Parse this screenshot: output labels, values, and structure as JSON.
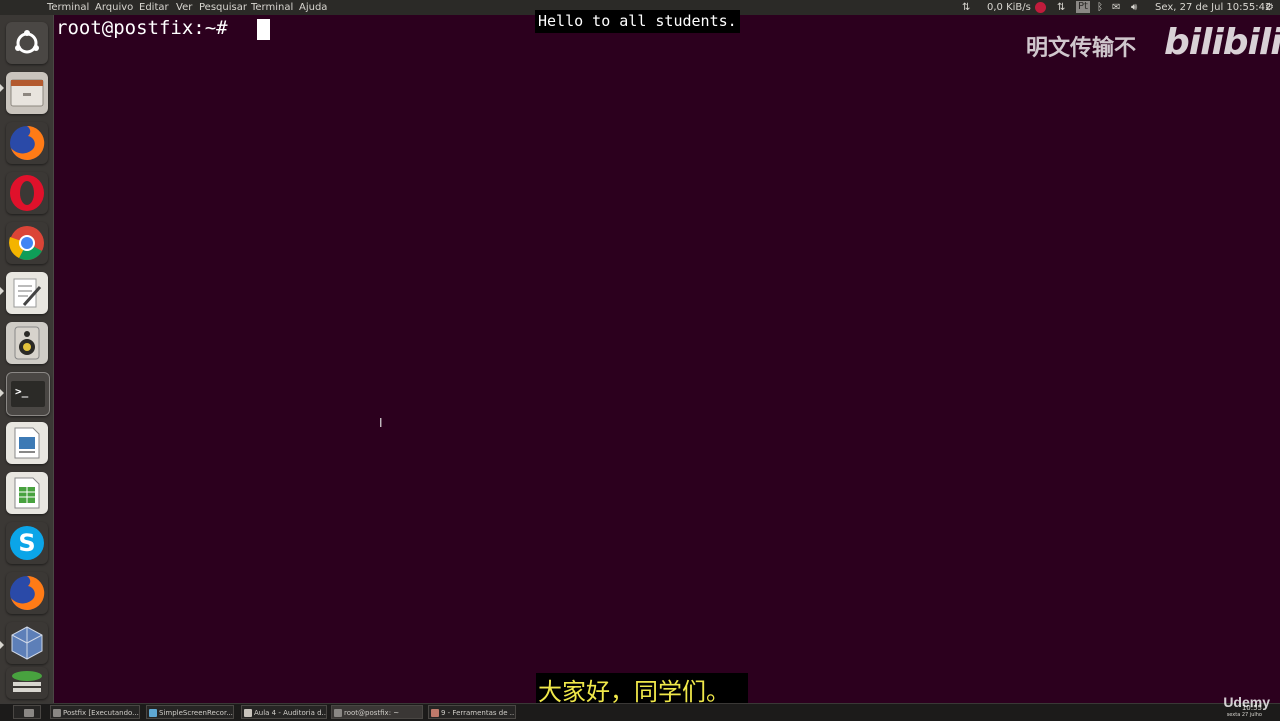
{
  "topbar": {
    "menu": [
      "Terminal",
      "Arquivo",
      "Editar",
      "Ver",
      "Pesquisar",
      "Terminal",
      "Ajuda"
    ],
    "network_speed": "0,0 KiB/s",
    "datetime": "Sex, 27 de Jul 10:55:42",
    "keyboard_layout": "Pt"
  },
  "terminal": {
    "prompt": "root@postfix:~# "
  },
  "subtitles": {
    "english": "Hello to all students.",
    "chinese": "大家好，同学们。"
  },
  "watermark": {
    "text": "明文传输不",
    "logo": "bilibili"
  },
  "launcher": {
    "icons": [
      "ubuntu-dash-icon",
      "files-icon",
      "firefox-icon",
      "opera-icon",
      "chrome-icon",
      "text-editor-icon",
      "speaker-icon",
      "terminal-icon",
      "libreoffice-writer-icon",
      "libreoffice-calc-icon",
      "skype-icon",
      "firefox-icon",
      "virtualbox-icon",
      "layers-icon"
    ]
  },
  "taskbar": {
    "tasks": [
      "Postfix [Executando...",
      "SimpleScreenRecor...",
      "Aula 4 - Auditoria d...",
      "root@postfix: ~",
      "9 - Ferramentas de ..."
    ],
    "clock_time": "10:55",
    "clock_date": "sexta 27 julho"
  },
  "brand": {
    "udemy": "Udemy"
  },
  "colors": {
    "terminal_bg": "#2c001e",
    "subtitle_cn": "#f0e84a"
  }
}
